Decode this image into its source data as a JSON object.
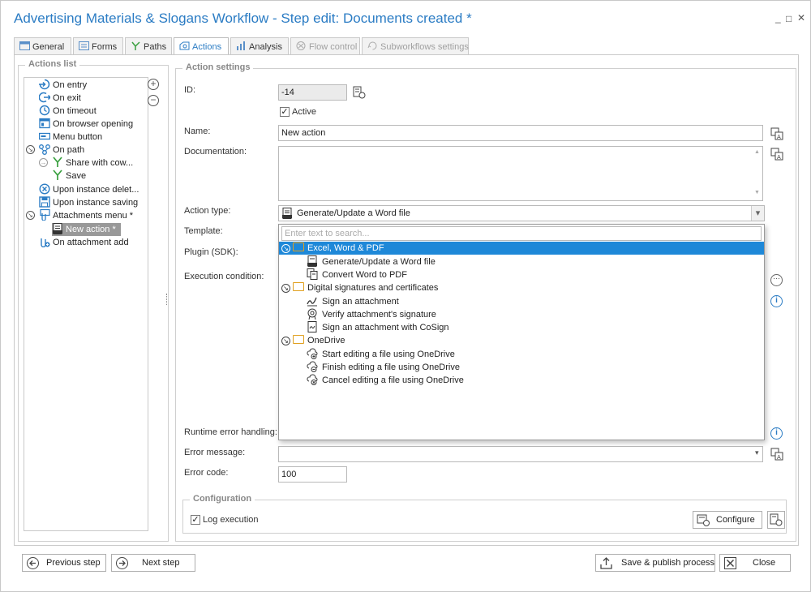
{
  "window": {
    "title": "Advertising Materials & Slogans Workflow - Step edit: Documents created *",
    "minimize_glyph": "_",
    "maximize_glyph": "□",
    "close_glyph": "✕"
  },
  "tabs": [
    {
      "label": "General",
      "icon": "general-icon",
      "state": "normal"
    },
    {
      "label": "Forms",
      "icon": "forms-icon",
      "state": "normal"
    },
    {
      "label": "Paths",
      "icon": "paths-icon",
      "state": "normal"
    },
    {
      "label": "Actions",
      "icon": "actions-icon",
      "state": "active"
    },
    {
      "label": "Analysis",
      "icon": "analysis-icon",
      "state": "normal"
    },
    {
      "label": "Flow control",
      "icon": "flow-control-icon",
      "state": "disabled"
    },
    {
      "label": "Subworkflows settings",
      "icon": "subworkflows-icon",
      "state": "disabled"
    }
  ],
  "actions_list": {
    "legend": "Actions list",
    "add_glyph": "+",
    "remove_glyph": "−",
    "items": [
      {
        "label": "On entry",
        "icon": "entry-icon"
      },
      {
        "label": "On exit",
        "icon": "exit-icon"
      },
      {
        "label": "On timeout",
        "icon": "clock-icon"
      },
      {
        "label": "On browser opening",
        "icon": "browser-icon"
      },
      {
        "label": "Menu button",
        "icon": "menu-button-icon"
      },
      {
        "label": "On path",
        "icon": "path-icon"
      },
      {
        "label": "Share with cow...",
        "icon": "path-branch-icon"
      },
      {
        "label": "Save",
        "icon": "path-branch-icon"
      },
      {
        "label": "Upon instance delet...",
        "icon": "delete-circle-icon"
      },
      {
        "label": "Upon instance saving",
        "icon": "save-icon"
      },
      {
        "label": "Attachments menu *",
        "icon": "attachments-menu-icon"
      },
      {
        "label": "New action *",
        "icon": "docx-icon"
      },
      {
        "label": "On attachment add",
        "icon": "attachment-add-icon"
      }
    ]
  },
  "action_settings": {
    "legend": "Action settings",
    "id_label": "ID:",
    "id_value": "-14",
    "active_label": "Active",
    "active_checked": true,
    "name_label": "Name:",
    "name_value": "New action",
    "documentation_label": "Documentation:",
    "documentation_value": "",
    "action_type_label": "Action type:",
    "action_type_value": "Generate/Update a Word file",
    "template_label": "Template:",
    "plugin_label": "Plugin (SDK):",
    "execution_condition_label": "Execution condition:",
    "runtime_error_label": "Runtime error handling:",
    "error_message_label": "Error message:",
    "error_message_value": "",
    "error_code_label": "Error code:",
    "error_code_value": "100",
    "check_glyph": "✓",
    "more_glyph": "···",
    "info_glyph": "i",
    "scroll_up_glyph": "▲",
    "scroll_down_glyph": "▼",
    "dropdown_glyph": "▾"
  },
  "action_type_dropdown": {
    "search_placeholder": "Enter text to search...",
    "groups": [
      {
        "label": "Excel, Word & PDF",
        "items": [
          "Generate/Update a Word file",
          "Convert Word to PDF"
        ]
      },
      {
        "label": "Digital signatures and certificates",
        "items": [
          "Sign an attachment",
          "Verify attachment's signature",
          "Sign an attachment with CoSign"
        ]
      },
      {
        "label": "OneDrive",
        "items": [
          "Start editing a file using OneDrive",
          "Finish editing a file using OneDrive",
          "Cancel editing a file using OneDrive"
        ]
      }
    ]
  },
  "configuration": {
    "legend": "Configuration",
    "log_execution_label": "Log execution",
    "log_execution_checked": true,
    "configure_label": "Configure"
  },
  "footer": {
    "previous_label": "Previous step",
    "next_label": "Next step",
    "save_publish_label": "Save & publish process",
    "close_label": "Close"
  },
  "colors": {
    "accent": "#2b7cc4",
    "highlight": "#1e88d8",
    "selected_node": "#999999"
  }
}
